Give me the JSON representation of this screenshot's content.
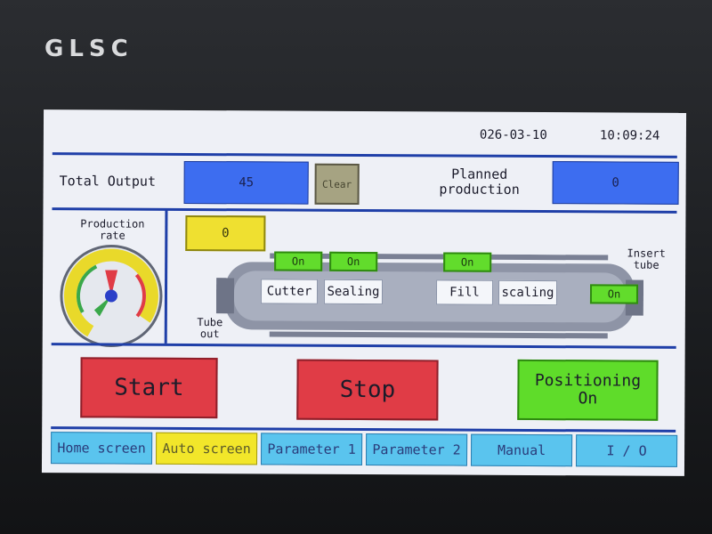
{
  "brand": "GLSC",
  "header": {
    "date": "026-03-10",
    "time": "10:09:24"
  },
  "output": {
    "total_label": "Total Output",
    "total_value": "45",
    "clear_label": "Clear",
    "planned_label": "Planned production",
    "planned_value": "0"
  },
  "rate": {
    "label": "Production rate",
    "counter_value": "0",
    "gauge_ticks": [
      "6",
      "12",
      "18",
      "24",
      "30",
      "36",
      "42",
      "48"
    ]
  },
  "machine": {
    "stations": [
      {
        "name": "Cutter",
        "status": "On"
      },
      {
        "name": "Sealing",
        "status": "On"
      },
      {
        "name": "Fill",
        "status": "On"
      },
      {
        "name": "scaling",
        "status": ""
      }
    ],
    "tube_out_label": "Tube out",
    "insert_tube_label": "Insert tube",
    "insert_tube_status": "On"
  },
  "controls": {
    "start_label": "Start",
    "stop_label": "Stop",
    "positioning_label": "Positioning",
    "positioning_state": "On"
  },
  "nav": [
    "Home screen",
    "Auto screen",
    "Parameter 1",
    "Parameter 2",
    "Manual",
    "I / O"
  ],
  "colors": {
    "accent_blue": "#3d6df0",
    "red": "#e03c46",
    "green": "#5fdc2a",
    "yellow": "#f2e62a",
    "cyan": "#5ac4ee"
  }
}
